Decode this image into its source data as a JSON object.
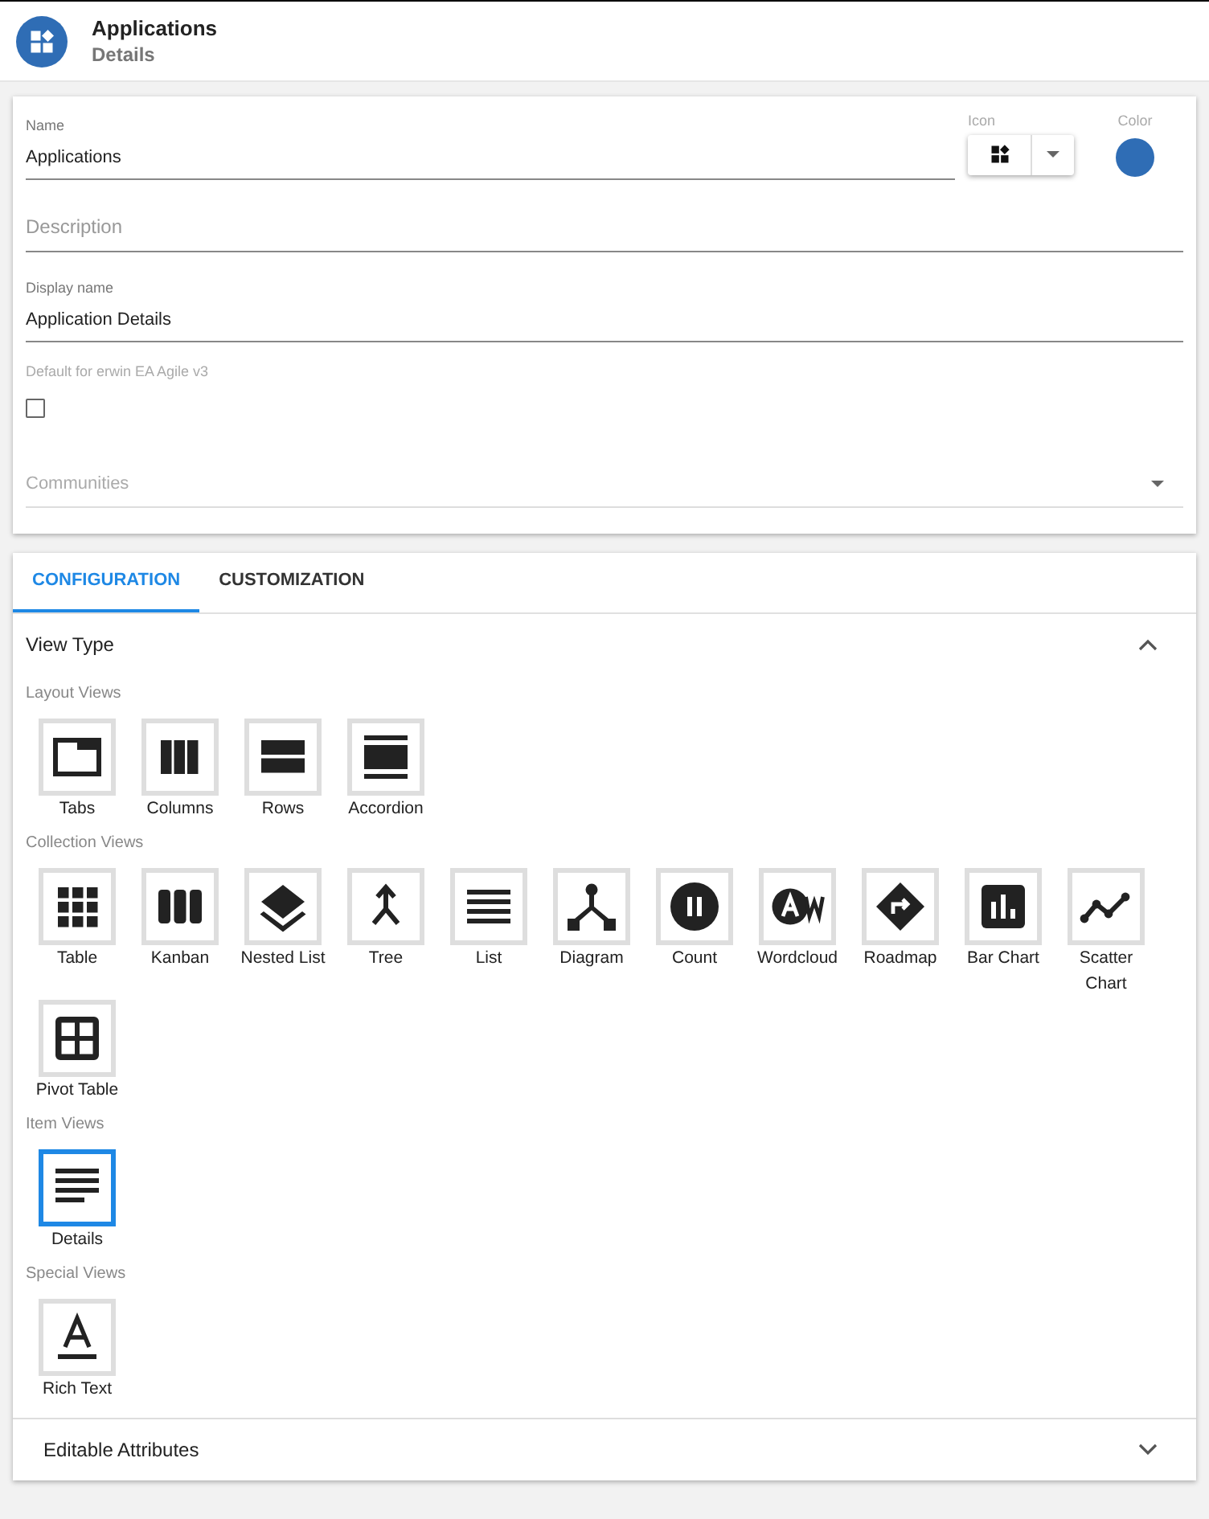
{
  "header": {
    "title": "Applications",
    "subtitle": "Details"
  },
  "form": {
    "name": {
      "label": "Name",
      "value": "Applications"
    },
    "icon": {
      "label": "Icon"
    },
    "color": {
      "label": "Color",
      "color": "#2f6db5"
    },
    "description": {
      "placeholder": "Description"
    },
    "display_name": {
      "label": "Display name",
      "value": "Application Details"
    },
    "default": {
      "label": "Default for erwin EA Agile v3",
      "checked": false
    },
    "communities": {
      "placeholder": "Communities"
    }
  },
  "tabs": [
    {
      "label": "CONFIGURATION",
      "selected": true
    },
    {
      "label": "CUSTOMIZATION",
      "selected": false
    }
  ],
  "view_type": {
    "title": "View Type",
    "expanded": true,
    "groups": [
      {
        "title": "Layout Views",
        "items": [
          {
            "kind": "tabs",
            "label": "Tabs",
            "selected": false
          },
          {
            "kind": "columns",
            "label": "Columns",
            "selected": false
          },
          {
            "kind": "rows",
            "label": "Rows",
            "selected": false
          },
          {
            "kind": "accordion",
            "label": "Accordion",
            "selected": false
          }
        ]
      },
      {
        "title": "Collection Views",
        "items": [
          {
            "kind": "table",
            "label": "Table",
            "selected": false
          },
          {
            "kind": "kanban",
            "label": "Kanban",
            "selected": false
          },
          {
            "kind": "nested",
            "label": "Nested List",
            "selected": false
          },
          {
            "kind": "tree",
            "label": "Tree",
            "selected": false
          },
          {
            "kind": "list",
            "label": "List",
            "selected": false
          },
          {
            "kind": "diagram",
            "label": "Diagram",
            "selected": false
          },
          {
            "kind": "count",
            "label": "Count",
            "selected": false
          },
          {
            "kind": "wordcloud",
            "label": "Wordcloud",
            "selected": false
          },
          {
            "kind": "roadmap",
            "label": "Roadmap",
            "selected": false
          },
          {
            "kind": "barchart",
            "label": "Bar Chart",
            "selected": false
          },
          {
            "kind": "scatter",
            "label": "Scatter Chart",
            "selected": false
          },
          {
            "kind": "pivot",
            "label": "Pivot Table",
            "selected": false
          }
        ]
      },
      {
        "title": "Item Views",
        "items": [
          {
            "kind": "details",
            "label": "Details",
            "selected": true
          }
        ]
      },
      {
        "title": "Special Views",
        "items": [
          {
            "kind": "richtext",
            "label": "Rich Text",
            "selected": false
          }
        ]
      }
    ]
  },
  "editable_attributes": {
    "title": "Editable Attributes",
    "expanded": false
  }
}
